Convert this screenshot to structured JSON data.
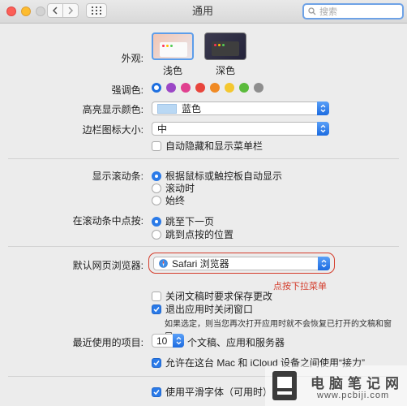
{
  "window": {
    "title": "通用",
    "search_placeholder": "搜索"
  },
  "appearance": {
    "label": "外观:",
    "options": [
      {
        "label": "浅色",
        "selected": true
      },
      {
        "label": "深色",
        "selected": false
      }
    ]
  },
  "accent": {
    "label": "强调色:",
    "colors": [
      "#1e6fe0",
      "#9b47c6",
      "#e0408f",
      "#e8453c",
      "#f08a24",
      "#f4c72f",
      "#5bbb3c",
      "#8e8e8e"
    ],
    "selected_index": 0
  },
  "highlight_color": {
    "label": "高亮显示颜色:",
    "value": "蓝色",
    "swatch": "#b9d8f4"
  },
  "sidebar_icon_size": {
    "label": "边栏图标大小:",
    "value": "中"
  },
  "menubar": {
    "label": "自动隐藏和显示菜单栏",
    "checked": false
  },
  "scrollbars": {
    "label": "显示滚动条:",
    "options": [
      {
        "label": "根据鼠标或触控板自动显示",
        "selected": true
      },
      {
        "label": "滚动时",
        "selected": false
      },
      {
        "label": "始终",
        "selected": false
      }
    ]
  },
  "click_scrollbar": {
    "label": "在滚动条中点按:",
    "options": [
      {
        "label": "跳至下一页",
        "selected": true
      },
      {
        "label": "跳到点按的位置",
        "selected": false
      }
    ]
  },
  "default_browser": {
    "label": "默认网页浏览器:",
    "value": "Safari 浏览器",
    "annotation": "点按下拉菜单"
  },
  "documents": {
    "ask_save": {
      "label": "关闭文稿时要求保存更改",
      "checked": false
    },
    "close_windows": {
      "label": "退出应用时关闭窗口",
      "checked": true
    },
    "note": "如果选定，则当您再次打开应用时就不会恢复已打开的文稿和窗口。"
  },
  "recent": {
    "label": "最近使用的项目:",
    "value": "10",
    "suffix": "个文稿、应用和服务器"
  },
  "handoff": {
    "label": "允许在这台 Mac 和 iCloud 设备之间使用“接力”",
    "checked": true
  },
  "font_smoothing": {
    "label": "使用平滑字体（可用时）",
    "checked": true
  },
  "watermark": {
    "title": "电脑笔记网",
    "url": "www.pcbiji.com"
  }
}
